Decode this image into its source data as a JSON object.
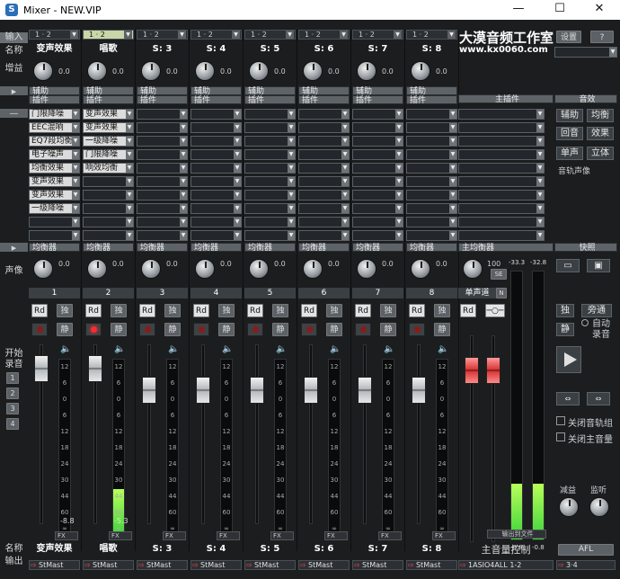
{
  "window": {
    "title": "Mixer - NEW.VIP",
    "min": "—",
    "max": "☐",
    "close": "✕"
  },
  "labels": {
    "input": "输入",
    "name": "名称",
    "gain": "增益",
    "pan": "声像",
    "rec_track": "开始\n录音",
    "name_bottom": "名称",
    "output": "输出"
  },
  "track_buttons": [
    "1",
    "2",
    "3",
    "4"
  ],
  "channels": [
    {
      "io": "1 · 2",
      "name": "变声效果",
      "gain": "0.0",
      "pan": "0.0",
      "num": "1",
      "peak": "-8.8",
      "bottom": "变声效果",
      "out": "StMast",
      "rec_lit": false,
      "inserts": [
        "门限降噪",
        "EEC混响",
        "EQ7段均衡",
        "电子噪声",
        "均衡效果",
        "变声效果",
        "变声效果",
        "一级降噪"
      ],
      "header": "插件",
      "eq": "均衡器"
    },
    {
      "io": "1 · 2",
      "name": "唱歌",
      "gain": "0.0",
      "pan": "0.0",
      "num": "2",
      "peak": "-5.3",
      "bottom": "唱歌",
      "out": "StMast",
      "rec_lit": true,
      "inserts": [
        "变声效果",
        "变声效果",
        "一级降噪",
        "门限降噪",
        "响效均衡"
      ],
      "header": "插件",
      "eq": "均衡器"
    },
    {
      "io": "1 · 2",
      "name": "S: 3",
      "gain": "0.0",
      "pan": "0.0",
      "num": "3",
      "peak": "",
      "bottom": "S: 3",
      "out": "StMast",
      "rec_lit": false,
      "inserts": [],
      "header": "插件",
      "eq": "均衡器"
    },
    {
      "io": "1 · 2",
      "name": "S: 4",
      "gain": "0.0",
      "pan": "0.0",
      "num": "4",
      "peak": "",
      "bottom": "S: 4",
      "out": "StMast",
      "rec_lit": false,
      "inserts": [],
      "header": "插件",
      "eq": "均衡器"
    },
    {
      "io": "1 · 2",
      "name": "S: 5",
      "gain": "0.0",
      "pan": "0.0",
      "num": "5",
      "peak": "",
      "bottom": "S: 5",
      "out": "StMast",
      "rec_lit": false,
      "inserts": [],
      "header": "插件",
      "eq": "均衡器"
    },
    {
      "io": "1 · 2",
      "name": "S: 6",
      "gain": "0.0",
      "pan": "0.0",
      "num": "6",
      "peak": "",
      "bottom": "S: 6",
      "out": "StMast",
      "rec_lit": false,
      "inserts": [],
      "header": "插件",
      "eq": "均衡器"
    },
    {
      "io": "1 · 2",
      "name": "S: 7",
      "gain": "0.0",
      "pan": "0.0",
      "num": "7",
      "peak": "",
      "bottom": "S: 7",
      "out": "StMast",
      "rec_lit": false,
      "inserts": [],
      "header": "插件",
      "eq": "均衡器"
    },
    {
      "io": "1 · 2",
      "name": "S: 8",
      "gain": "0.0",
      "pan": "0.0",
      "num": "8",
      "peak": "",
      "bottom": "S: 8",
      "out": "StMast",
      "rec_lit": false,
      "inserts": [],
      "header": "插件",
      "eq": "均衡器"
    }
  ],
  "strip_buttons": {
    "read": "Rd",
    "solo": "独",
    "mute": "静",
    "aux": "辅助",
    "fx": "FX"
  },
  "scale": [
    "12",
    "6",
    "0",
    "6",
    "12",
    "18",
    "24",
    "30",
    "44",
    "60",
    "∞"
  ],
  "brand": {
    "line1": "大漠音频工作室",
    "line2": "www.kx0060.com"
  },
  "master": {
    "header": "主插件",
    "eq": "主均衡器",
    "pan": "100",
    "se": "SE",
    "label": "单声道",
    "ch": "N",
    "peaks": [
      "-33.3",
      "-32.8"
    ],
    "floor": [
      "-0.8",
      "-0.8"
    ],
    "bottom": "主音量控制",
    "out": "1ASIO4ALL 1-2",
    "fx": "输出到文件"
  },
  "right": {
    "settings": "设置",
    "help": "?",
    "header": "音效",
    "aux_btn": "辅助",
    "eq_btn": "均衡",
    "reverb_btn": "回音",
    "fx_btn": "效果",
    "mono_btn": "单声",
    "stereo_btn": "立体",
    "mono_caption": "音轨声像",
    "save": "快照",
    "solo": "独",
    "mix": "旁通",
    "mute": "静",
    "auto_rec": "自动\n录音",
    "close_track": "关闭音轨组",
    "close_master": "关闭主音量",
    "monitor": "监听",
    "duck": "减益",
    "afl": "AFL",
    "out": "3·4"
  }
}
